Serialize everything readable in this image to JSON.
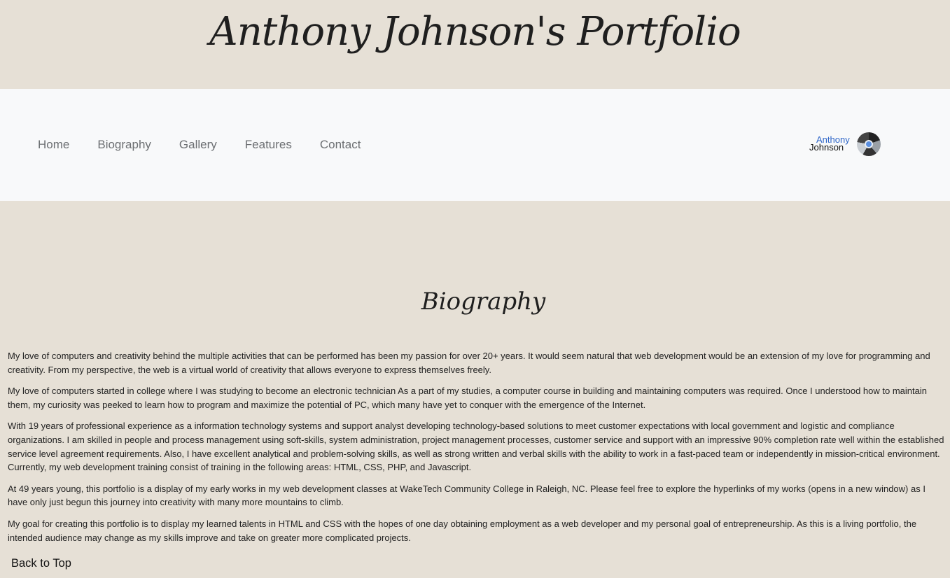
{
  "header": {
    "title": "Anthony Johnson's Portfolio"
  },
  "nav": {
    "items": [
      {
        "label": "Home"
      },
      {
        "label": "Biography"
      },
      {
        "label": "Gallery"
      },
      {
        "label": "Features"
      },
      {
        "label": "Contact"
      }
    ],
    "logo": {
      "first_name": "Anthony",
      "last_name": "Johnson",
      "icon": "camera-lens-icon"
    }
  },
  "main": {
    "section_title": "Biography",
    "paragraphs": [
      "My love of computers and creativity behind the multiple activities that can be performed has been my passion for over 20+ years. It would seem natural that web development would be an extension of my love for programming and creativity. From my perspective, the web is a virtual world of creativity that allows everyone to express themselves freely.",
      "My love of computers started in college where I was studying to become an electronic technician As a part of my studies, a computer course in building and maintaining computers was required. Once I understood how to maintain them, my curiosity was peeked to learn how to program and maximize the potential of PC, which many have yet to conquer with the emergence of the Internet.",
      "With 19 years of professional experience as a information technology systems and support analyst developing technology-based solutions to meet customer expectations with local government and logistic and compliance organizations. I am skilled in people and process management using soft-skills, system administration, project management processes, customer service and support with an impressive 90% completion rate well within the established service level agreement requirements. Also, I have excellent analytical and problem-solving skills, as well as strong written and verbal skills with the ability to work in a fast-paced team or independently in mission-critical environment. Currently, my web development training consist of training in the following areas: HTML, CSS, PHP, and Javascript.",
      "At 49 years young, this portfolio is a display of my early works in my web development classes at WakeTech Community College in Raleigh, NC. Please feel free to explore the hyperlinks of my works (opens in a new window) as I have only just begun this journey into creativity with many more mountains to climb.",
      "My goal for creating this portfolio is to display my learned talents in HTML and CSS with the hopes of one day obtaining employment as a web developer and my personal goal of entrepreneurship. As this is a living portfolio, the intended audience may change as my skills improve and take on greater more complicated projects."
    ],
    "back_to_top": "Back to Top"
  },
  "colors": {
    "page_background": "#e6e0d6",
    "navbar_background": "#f8f9fa",
    "nav_link": "#6c6f72",
    "logo_blue": "#2f66c8"
  }
}
